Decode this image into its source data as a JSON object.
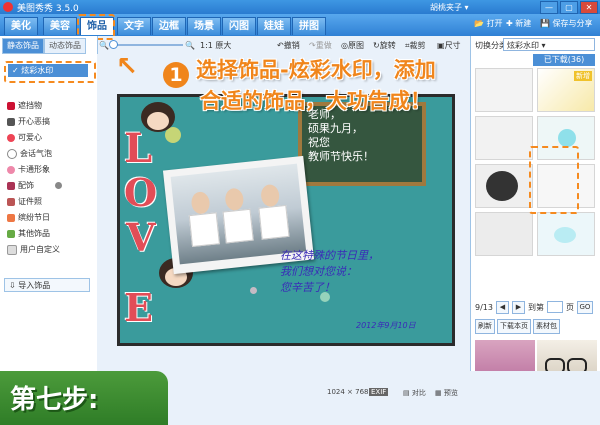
{
  "app": {
    "title": "美图秀秀 3.5.0",
    "user": "胡桃夹子 ▾"
  },
  "window_buttons": [
    "—",
    "▢",
    "✕"
  ],
  "menu": {
    "tabs": [
      "美化",
      "美容",
      "饰品",
      "文字",
      "边框",
      "场景",
      "闪图",
      "娃娃",
      "拼图"
    ],
    "active": "饰品",
    "right": {
      "open": "打开",
      "new": "新建",
      "save_share": "保存与分享"
    }
  },
  "left_panel": {
    "tabs": [
      "静态饰品",
      "动态饰品"
    ],
    "selected": "炫彩水印",
    "items": [
      "遮挡物",
      "开心恶搞",
      "可爱心",
      "会话气泡",
      "卡通形象",
      "配饰",
      "证件照",
      "缤纷节日",
      "其他饰品",
      "用户自定义"
    ],
    "import": "导入饰品"
  },
  "toolbar": {
    "fit": "1:1 原大",
    "undo": "撤销",
    "redo": "重做",
    "original": "原图",
    "rotate": "旋转",
    "crop": "裁剪",
    "resize": "尺寸"
  },
  "canvas": {
    "chalkboard": [
      "老师，",
      "硕果九月，",
      "祝您",
      "教师节快乐！"
    ],
    "blessing": [
      "在这特殊的节日里，",
      "我们想对您说：",
      "您辛苦了！"
    ],
    "date": "2012年9月10日",
    "letters": [
      "L",
      "O",
      "V",
      "E"
    ]
  },
  "callout": {
    "number": "1",
    "line1": "选择饰品-炫彩水印，添加",
    "line2": "合适的饰品，大功告成！"
  },
  "right_panel": {
    "category_label": "切换分类",
    "category": "炫彩水印",
    "downloaded": "已下载(36)",
    "pager": "9/13",
    "goto_prefix": "到第",
    "goto_suffix": "页",
    "go": "GO",
    "actions": [
      "刷新",
      "下载本页",
      "素材包"
    ],
    "new_badge": "新增"
  },
  "status": {
    "size": "1024 × 768",
    "exif": "EXIF",
    "compare": "对比",
    "preview": "预览"
  },
  "step": "第七步:",
  "colors": {
    "accent": "#f0851b",
    "title_blue": "#2a7bd0",
    "step_green": "#3a8b30"
  }
}
